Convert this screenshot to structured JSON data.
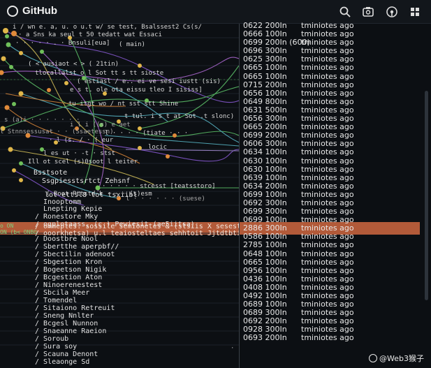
{
  "app": {
    "title": "GitHub"
  },
  "header": {
    "icons": [
      "search-icon",
      "camera-icon",
      "compass-icon",
      "grid-icon"
    ]
  },
  "graph_labels": [
    "i  / wn e.  a, u. o  u.t w/ se  test, Bsalssest2 Cs(s/ ",
    "· a Sns ka  seul t 50  tedatt wat  Essaci",
    "·  ·  ·  ·  ·  . ·  Bnsuli[eua]",
    "( main)",
    "( < ausiaot  < > ( 21tin)",
    "tlocallalst o l  Sot tt s tt sioste",
    "( estiasl / e.. ei ve  sesi  iustt  (sis)",
    "e s  t. ole ota  eissu tleo  I  sisiss]",
    "tu   itgt  wo /  nt  sst stt Shine",
    "t  tul. i  s t at  Sot  .t  slonc)",
    "i  l   i   ((s) e  aet",
    "l  ·  ·  ·  ·  (tiate  ·  ·  ·",
    "· l  (s.  / ·  ( eur",
    "locic",
    "l  es ut  ·  -t  ·  stst",
    "Ill  ot  scel  (s)0soot l  teiter",
    "·  ·  ·  ·  ·  stcesst [teatsstoro]",
    "( Boot Pttstd  k   ·  ·  ·  (s)esm",
    "s   (a)i   ·  ·  ·  ·  ·  ·  ·",
    "l  Stnnsessusat  ·  ·  (Ssaetessn)",
    "l  ·  ·  ·  ·  ·  ·  (suese)",
    "· ·  ·  ·  ·  ·  ·  ·  ·"
  ],
  "commits": [
    "Bsstsote",
    "Ssgpiesstsrtct Zehsnf",
    "lot   ettsl8 tot  tsxiibl",
    "Inooptomm",
    "Lnepting Kepie",
    "/  Ronestore Mky",
    "/ ogplotaass,  (c.)  Pewiesit  (ae5iitsa)",
    "/  Doostbre Nool",
    "/  Sbertthe aperpbf//",
    "/  Sbectilin adenoot",
    "/  Sbgestion Kron",
    "/  Bogeetson Nigik",
    "/  Bcgestion Aton",
    "/ Ninoerenestest",
    "/  Sbcila Meer",
    "/  Tomendel",
    "/  Sitaiono Retreuit",
    "/  Sneng Nnlter",
    "/  Bcgesl Nunnon",
    "/  Snaeanne Raeion",
    "/  Soroub",
    "/  Sura soy",
    "/  Scauna Denont",
    "/ Sleaonge Sd"
  ],
  "hl_lines": [
    "/ ommeptes. sossile semionetes   &  (stsiis  X sesestt)",
    "/ ooorkhetsa)  u.l  teaiosteltaes  sehhtoit Jjtdtbtittiit)"
  ],
  "on_tags": [
    "o ON",
    "ON  (b< ONBO"
  ],
  "table": {
    "ids": [
      "0622 200In",
      "0666 100In",
      "0699 200In (600)",
      "0696 300In",
      "0625 300In",
      "0665 100In",
      "0665 100In",
      "0715 200In",
      "0656 100In",
      "0649 800In",
      "0631 500In",
      "0656 300In",
      "0665 200In",
      "0699 200In",
      "0606 300In",
      "0634 100In",
      "0630 100In",
      "0630 100In",
      "0639 100In",
      "0634 200In",
      "0699 100In",
      "0692 300In",
      "0699 300In",
      "0699 100In",
      "2886 300In",
      "0586 100In",
      "2785 100In",
      "0648 100In",
      "0665 100In",
      "0956 100In",
      "0436 100In",
      "0408 100In",
      "0492 100In",
      "0689 100In",
      "0689 300In",
      "0692 200In",
      "0928 300In",
      "0693 200In"
    ],
    "times": [
      "tminiotes ago",
      "tminiotes ago",
      "tminiotes ago",
      "tminiotes ago",
      "tminiotes ago",
      "tminiotes ago",
      "tminiotes ago",
      "tminiotes ago",
      "tminiotes ago",
      "tminiotes ago",
      "tminiotes ago",
      "tminiotes ago",
      "tminiotes ago",
      "tminiotes ago",
      "tminiotes ago",
      "tminiotes ago",
      "tminiotes ago",
      "tminiotes ago",
      "tminiotes ago",
      "tminiotes ago",
      "tminiotes ago",
      "tminiotes ago",
      "tminiotes ago",
      "tminiotes ago",
      "tminiotes ago",
      "tminiotes ago",
      "tminiotes ago",
      "tminiotes ago",
      "tminiotes ago",
      "tminiotes ago",
      "tminiotes ago",
      "tminiotes ago",
      "tminiotes ago",
      "tminiotes ago",
      "tminiotes ago",
      "tminiotes ago",
      "tminiotes ago",
      "tminiotes ago"
    ]
  },
  "watermark": "@Web3猴子",
  "colors": {
    "highlight": "#c1613d",
    "node_yellow": "#e0b64a",
    "node_green": "#6fbf5a",
    "node_orange": "#e08a3a",
    "line_purple": "#8a5bd6",
    "line_green": "#5ec46a",
    "line_cyan": "#59b9c9",
    "line_yellow": "#d6c25a"
  }
}
